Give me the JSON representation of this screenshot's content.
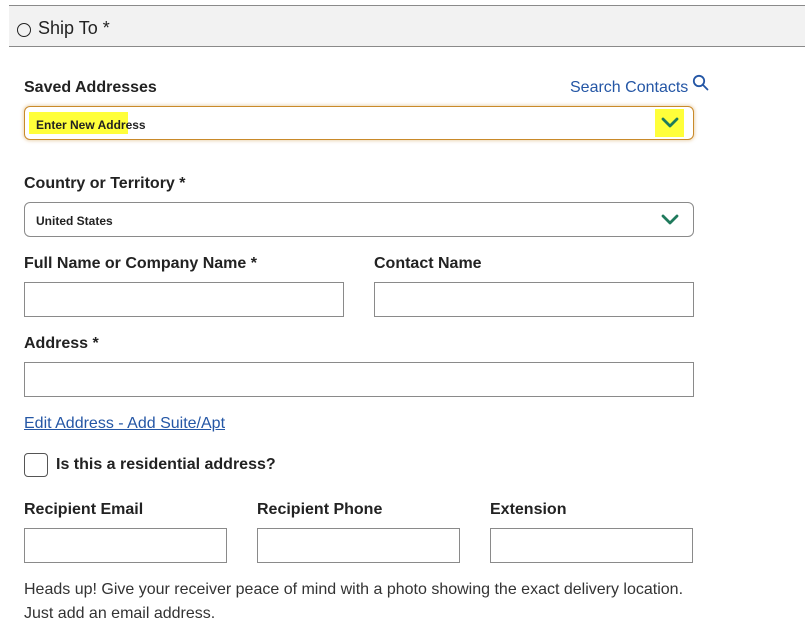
{
  "section": {
    "title": "Ship To *"
  },
  "saved_addresses": {
    "label": "Saved Addresses",
    "search_contacts": "Search Contacts",
    "selected_value": "Enter New Address",
    "icon": "search-icon"
  },
  "country": {
    "label": "Country or Territory *",
    "selected_value": "United States"
  },
  "full_name": {
    "label": "Full Name or Company Name *",
    "value": ""
  },
  "contact_name": {
    "label": "Contact Name",
    "value": ""
  },
  "address": {
    "label": "Address *",
    "value": ""
  },
  "edit_address_link": "Edit Address - Add Suite/Apt",
  "residential": {
    "label": "Is this a residential address?",
    "checked": false
  },
  "recipient_email": {
    "label": "Recipient Email",
    "value": ""
  },
  "recipient_phone": {
    "label": "Recipient Phone",
    "value": ""
  },
  "extension": {
    "label": "Extension",
    "value": ""
  },
  "note": {
    "line1": "Heads up! Give your receiver peace of mind with a photo showing the exact delivery location.",
    "line2": "Just add an email address."
  },
  "colors": {
    "chevron": "#1f7a5c",
    "link": "#2456a5",
    "highlight": "#ffff3a"
  }
}
